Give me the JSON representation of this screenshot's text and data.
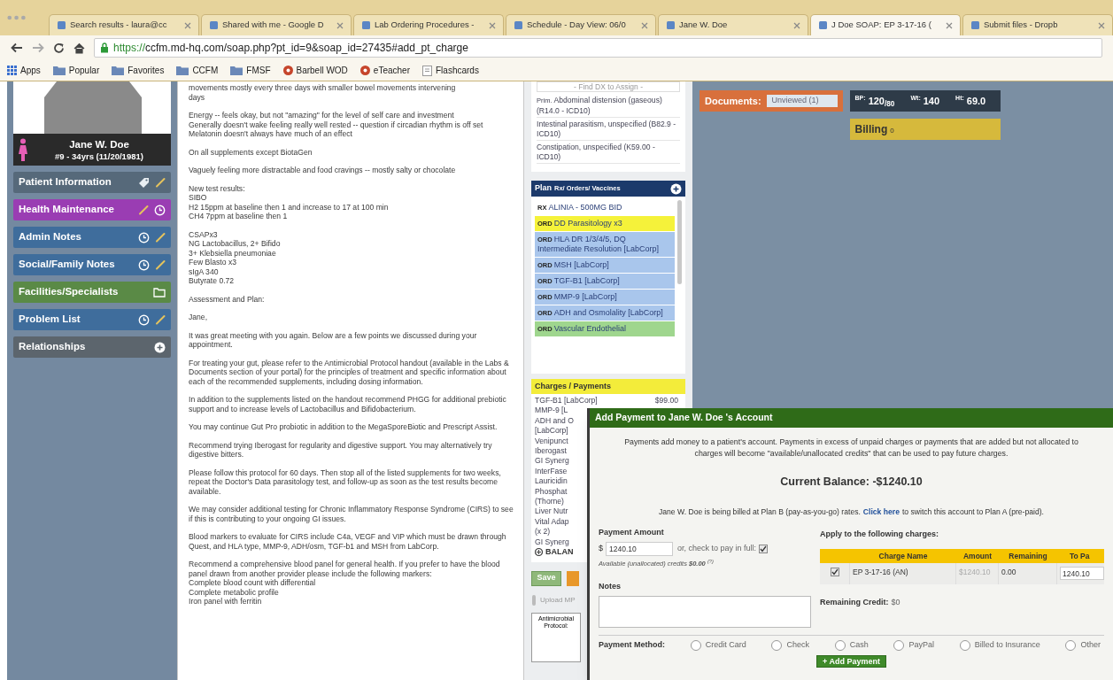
{
  "browser": {
    "tabs": [
      {
        "label": "Search results - laura@cc",
        "selected": false
      },
      {
        "label": "Shared with me - Google D",
        "selected": false
      },
      {
        "label": "Lab Ordering Procedures -",
        "selected": false
      },
      {
        "label": "Schedule - Day View: 06/0",
        "selected": false
      },
      {
        "label": "Jane W. Doe",
        "selected": false
      },
      {
        "label": "J Doe SOAP: EP 3-17-16 (",
        "selected": true
      },
      {
        "label": "Submit files - Dropb",
        "selected": false
      }
    ],
    "url_scheme": "https://",
    "url_rest": "ccfm.md-hq.com/soap.php?pt_id=9&soap_id=27435#add_pt_charge",
    "bookmarks": [
      {
        "label": "Apps",
        "kind": "apps"
      },
      {
        "label": "Popular",
        "kind": "folder"
      },
      {
        "label": "Favorites",
        "kind": "folder"
      },
      {
        "label": "CCFM",
        "kind": "folder"
      },
      {
        "label": "FMSF",
        "kind": "folder"
      },
      {
        "label": "Barbell WOD",
        "kind": "site"
      },
      {
        "label": "eTeacher",
        "kind": "site"
      },
      {
        "label": "Flashcards",
        "kind": "page"
      }
    ]
  },
  "patient": {
    "name": "Jane W. Doe",
    "info": "#9 - 34yrs (11/20/1981)"
  },
  "sidebar": {
    "items": [
      {
        "label": "Patient Information",
        "color": "#56697a",
        "kind": "tagged"
      },
      {
        "label": "Health Maintenance",
        "color": "#9a3db3",
        "kind": "tracked"
      },
      {
        "label": "Admin Notes",
        "color": "#3f6d9c",
        "kind": "notes"
      },
      {
        "label": "Social/Family Notes",
        "color": "#3f6d9c",
        "kind": "notes"
      },
      {
        "label": "Facilities/Specialists",
        "color": "#5a8a46",
        "kind": "directory"
      },
      {
        "label": "Problem List",
        "color": "#3f6d9c",
        "kind": "notes"
      },
      {
        "label": "Relationships",
        "color": "#5c656d",
        "kind": "addable"
      }
    ]
  },
  "notes": [
    "movements mostly every three days with smaller bowel movements intervening\ndays",
    "Energy -- feels okay, but not \"amazing\" for the level of self care and investment\nGenerally doesn't wake feeling really well rested -- question if circadian rhythm is off set\nMelatonin doesn't always have much of an effect",
    "On all supplements except BiotaGen",
    "Vaguely feeling more distractable and food cravings -- mostly salty or chocolate",
    "New test results:\nSIBO\nH2 15ppm at baseline then 1 and increase to 17 at 100 min\nCH4 7ppm at baseline then 1",
    "CSAPx3\nNG Lactobacillus, 2+ Bifido\n3+ Klebsiella pneumoniae\nFew Blasto x3\nsIgA 340\nButyrate 0.72",
    "Assessment and Plan:",
    "Jane,",
    "It was great meeting with you again. Below are a few points we discussed during your appointment.",
    "For treating your gut, please refer to the Antimicrobial Protocol handout (available in the Labs & Documents section of your portal) for the principles of treatment and specific information about each of the recommended supplements, including dosing information.",
    "In addition to the supplements listed on the handout recommend PHGG for additional prebiotic support and to increase levels of Lactobacillus and Bifidobacterium.",
    "You may continue Gut Pro probiotic in addition to the MegaSporeBiotic and Prescript Assist.",
    "Recommend trying Iberogast for regularity and digestive support. You may alternatively try digestive bitters.",
    "Please follow this protocol for 60 days. Then stop all of the listed supplements for two weeks, repeat the Doctor's Data parasitology test, and follow-up as soon as the test results become available.",
    "We may consider additional testing for Chronic Inflammatory Response Syndrome (CIRS) to see if this is contributing to your ongoing GI issues.",
    "Blood markers to evaluate for CIRS include C4a, VEGF and VIP which must be drawn through Quest, and HLA type, MMP-9, ADH/osm, TGF-b1 and MSH from LabCorp.",
    "Recommend a comprehensive blood panel for general health. If you prefer to have the blood panel drawn from another provider please include the following markers:\nComplete blood count with differential\nComplete metabolic profile\nIron panel with ferritin"
  ],
  "diagnoses": {
    "placeholder": "- Find DX to Assign -",
    "items": [
      {
        "prefix": "Prim.",
        "text": "Abdominal distension (gaseous) (R14.0 - ICD10)"
      },
      {
        "text": "Intestinal parasitism, unspecified (B82.9 - ICD10)"
      },
      {
        "text": "Constipation, unspecified (K59.00 - ICD10)"
      }
    ]
  },
  "plan": {
    "title": "Plan",
    "subtitle": "Rx/ Orders/ Vaccines",
    "items": [
      {
        "tag": "RX",
        "label": "ALINIA - 500MG BID",
        "color": "#ffffff"
      },
      {
        "tag": "ORD",
        "label": "DD Parasitology x3",
        "color": "#f5f23a"
      },
      {
        "tag": "ORD",
        "label": "HLA DR 1/3/4/5, DQ Intermediate Resolution [LabCorp]",
        "color": "#a9c6ec"
      },
      {
        "tag": "ORD",
        "label": "MSH [LabCorp]",
        "color": "#a9c6ec"
      },
      {
        "tag": "ORD",
        "label": "TGF-B1 [LabCorp]",
        "color": "#a9c6ec"
      },
      {
        "tag": "ORD",
        "label": "MMP-9 [LabCorp]",
        "color": "#a9c6ec"
      },
      {
        "tag": "ORD",
        "label": "ADH and Osmolality [LabCorp]",
        "color": "#a9c6ec"
      },
      {
        "tag": "ORD",
        "label": "Vascular Endothelial",
        "color": "#9fd68e"
      }
    ]
  },
  "charges": {
    "title": "Charges / Payments",
    "items": [
      {
        "name": "TGF-B1 [LabCorp]",
        "amount": "$99.00"
      },
      {
        "name": "MMP-9 [L"
      },
      {
        "name": "ADH and O"
      },
      {
        "name": "[LabCorp]"
      },
      {
        "name": "Venipunct"
      },
      {
        "name": "Iberogast"
      },
      {
        "name": "GI Synerg"
      },
      {
        "name": "InterFase"
      },
      {
        "name": "Lauricidin"
      },
      {
        "name": "Phosphat"
      },
      {
        "name": "(Thorne)"
      },
      {
        "name": "Liver Nutr"
      },
      {
        "name": "Vital Adap"
      },
      {
        "name": "(x 2)"
      },
      {
        "name": "GI Synerg"
      }
    ],
    "balance": "BALAN",
    "save": "Save",
    "upload": "Upload MP",
    "thumbnail": "Antimicrobial\nProtocol:"
  },
  "documents": {
    "label": "Documents:",
    "filter": "Unviewed (1)"
  },
  "vitals": [
    {
      "label": "BP:",
      "value": "120$_{/80}$"
    },
    {
      "label": "Wt:",
      "value": "140"
    },
    {
      "label": "Ht:",
      "value": "69.0"
    }
  ],
  "billing": {
    "label": "Billing",
    "count": "0"
  },
  "dialog": {
    "title": "Add Payment to Jane W. Doe 's Account",
    "intro": "Payments add money to a patient's account. Payments in excess of unpaid charges or payments that are added but not allocated to\ncharges will become \"available/unallocated credits\" that can be used to pay future charges.",
    "balance": "Current Balance: -$1240.10",
    "plan_before": "Jane W. Doe is being billed at Plan B (pay-as-you-go) rates.",
    "plan_link": "Click here",
    "plan_after": "to switch this account to Plan A (pre-paid).",
    "amount_label": "Payment Amount",
    "currency": "$",
    "amount": "1240.10",
    "pay_full_label": "or, check to pay in full:",
    "pay_full_checked": true,
    "credits": "Available (unallocated) credits **$0.00** $^{(?)}$",
    "notes_label": "Notes",
    "apply_label": "Apply to the following charges:",
    "columns": [
      "Charge Name",
      "Amount",
      "Remaining",
      "To Pa"
    ],
    "rows": [
      {
        "checked": true,
        "name": "EP 3-17-16 (AN)",
        "amount": "$1240.10",
        "remaining": "0.00",
        "to_pay": "1240.10"
      }
    ],
    "remaining_label": "Remaining Credit:",
    "remaining_value": "$0",
    "method_label": "Payment Method:",
    "methods": [
      {
        "label": "Credit Card",
        "selected": false
      },
      {
        "label": "Check",
        "selected": false
      },
      {
        "label": "Cash",
        "selected": false
      },
      {
        "label": "PayPal",
        "selected": false
      },
      {
        "label": "Billed to Insurance",
        "selected": false
      },
      {
        "label": "Other",
        "selected": false
      }
    ],
    "submit": "+ Add Payment"
  }
}
